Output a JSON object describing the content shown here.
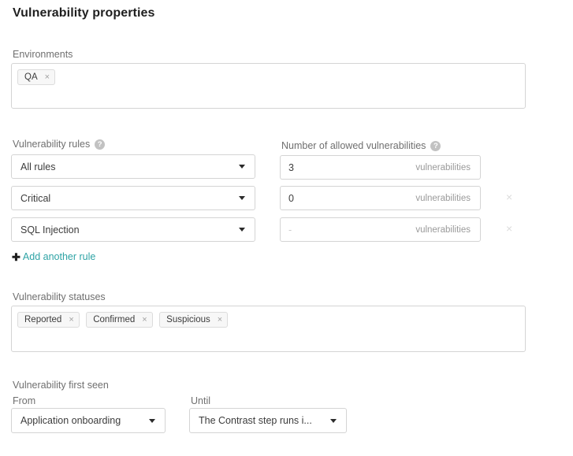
{
  "page": {
    "title": "Vulnerability properties"
  },
  "environments": {
    "label": "Environments",
    "tags": [
      {
        "label": "QA",
        "remove_icon": "close-icon",
        "remove_glyph": "×"
      }
    ]
  },
  "vulnerability_rules": {
    "label": "Vulnerability rules",
    "help_icon": "help-icon",
    "help_glyph": "?",
    "rows": [
      {
        "rule_value": "All rules",
        "caret_icon": "chevron-down-icon"
      },
      {
        "rule_value": "Critical",
        "caret_icon": "chevron-down-icon"
      },
      {
        "rule_value": "SQL Injection",
        "caret_icon": "chevron-down-icon"
      }
    ],
    "add_rule": {
      "plus_icon": "plus-icon",
      "plus_glyph": "✚",
      "label": "Add another rule",
      "color": "#2ea3a5"
    }
  },
  "allowed_vulnerabilities": {
    "label": "Number of allowed vulnerabilities",
    "help_icon": "help-icon",
    "help_glyph": "?",
    "rows": [
      {
        "value": "3",
        "placeholder": "",
        "suffix": "vulnerabilities",
        "removable": false
      },
      {
        "value": "0",
        "placeholder": "",
        "suffix": "vulnerabilities",
        "removable": true
      },
      {
        "value": "",
        "placeholder": "-",
        "suffix": "vulnerabilities",
        "removable": true
      }
    ],
    "remove_icon": "close-icon",
    "remove_glyph": "×"
  },
  "vulnerability_statuses": {
    "label": "Vulnerability statuses",
    "tags": [
      {
        "label": "Reported",
        "remove_glyph": "×"
      },
      {
        "label": "Confirmed",
        "remove_glyph": "×"
      },
      {
        "label": "Suspicious",
        "remove_glyph": "×"
      }
    ]
  },
  "vulnerability_first_seen": {
    "label": "Vulnerability first seen",
    "from": {
      "label": "From",
      "value": "Application onboarding",
      "caret_icon": "chevron-down-icon"
    },
    "until": {
      "label": "Until",
      "value": "The Contrast step runs i...",
      "caret_icon": "chevron-down-icon"
    }
  },
  "colors": {
    "accent": "#2ea3a5",
    "border": "#d4d4d4",
    "label_text": "#6f6f6f",
    "value_text": "#3c3c3c",
    "muted_text": "#9a9a9a"
  }
}
